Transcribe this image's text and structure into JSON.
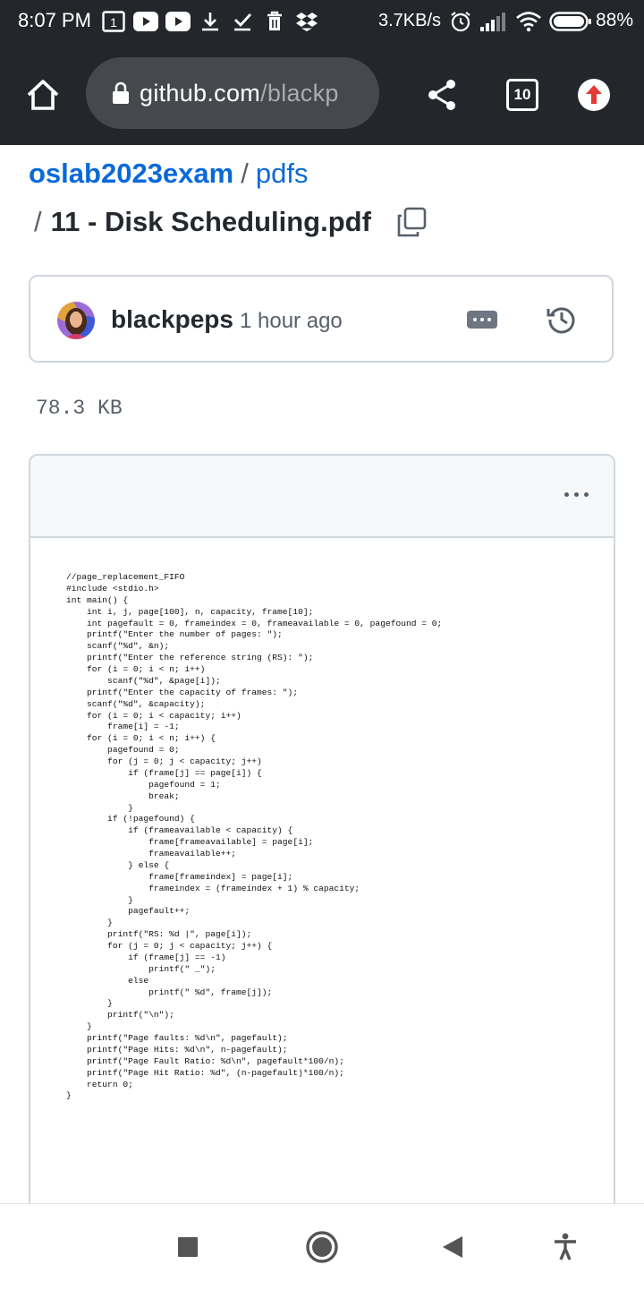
{
  "status_bar": {
    "time": "8:07 PM",
    "net_speed": "3.7KB/s",
    "battery": "88%",
    "icons": [
      "calendar-icon",
      "youtube-icon",
      "youtube-icon",
      "download-icon",
      "checkmark-icon",
      "trash-icon",
      "dropbox-icon",
      "alarm-icon",
      "signal-icon",
      "wifi-icon",
      "battery-icon"
    ]
  },
  "browser": {
    "url_host": "github.com",
    "url_path": "/blackp",
    "tab_count": "10",
    "icons": [
      "home-icon",
      "lock-icon",
      "share-icon",
      "tab-switcher-icon",
      "update-icon"
    ]
  },
  "breadcrumb": {
    "repo": "oslab2023exam",
    "separator": "/",
    "directory": "pdfs",
    "file_name": "11 - Disk Scheduling.pdf"
  },
  "commit": {
    "author": "blackpeps",
    "time": "1 hour ago"
  },
  "file_size": "78.3 KB",
  "pdf": {
    "code_lines": [
      "//page_replacement_FIFO",
      "#include <stdio.h>",
      "int main() {",
      "    int i, j, page[100], n, capacity, frame[10];",
      "    int pagefault = 0, frameindex = 0, frameavailable = 0, pagefound = 0;",
      "    printf(\"Enter the number of pages: \");",
      "    scanf(\"%d\", &n);",
      "    printf(\"Enter the reference string (RS): \");",
      "    for (i = 0; i < n; i++)",
      "        scanf(\"%d\", &page[i]);",
      "    printf(\"Enter the capacity of frames: \");",
      "    scanf(\"%d\", &capacity);",
      "    for (i = 0; i < capacity; i++)",
      "        frame[i] = -1;",
      "    for (i = 0; i < n; i++) {",
      "        pagefound = 0;",
      "        for (j = 0; j < capacity; j++)",
      "            if (frame[j] == page[i]) {",
      "                pagefound = 1;",
      "                break;",
      "            }",
      "        if (!pagefound) {",
      "            if (frameavailable < capacity) {",
      "                frame[frameavailable] = page[i];",
      "                frameavailable++;",
      "            } else {",
      "                frame[frameindex] = page[i];",
      "                frameindex = (frameindex + 1) % capacity;",
      "            }",
      "            pagefault++;",
      "        }",
      "        printf(\"RS: %d |\", page[i]);",
      "        for (j = 0; j < capacity; j++) {",
      "            if (frame[j] == -1)",
      "                printf(\" _\");",
      "            else",
      "                printf(\" %d\", frame[j]);",
      "        }",
      "        printf(\"\\n\");",
      "    }",
      "    printf(\"Page faults: %d\\n\", pagefault);",
      "    printf(\"Page Hits: %d\\n\", n-pagefault);",
      "    printf(\"Page Fault Ratio: %d\\n\", pagefault*100/n);",
      "    printf(\"Page Hit Ratio: %d\", (n-pagefault)*100/n);",
      "    return 0;",
      "}"
    ]
  },
  "nav_bar": {
    "icons": [
      "recents-icon",
      "home-icon",
      "back-icon",
      "accessibility-icon"
    ]
  }
}
